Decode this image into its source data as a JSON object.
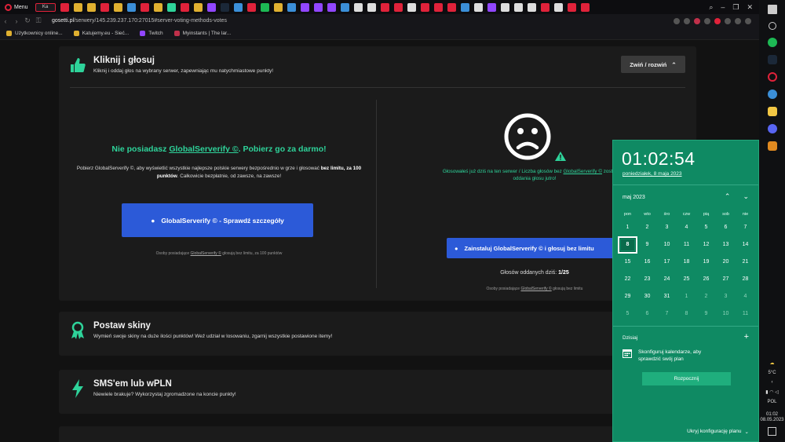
{
  "browser": {
    "menu_label": "Menu",
    "active_tab_label": "Ka",
    "url_host": "gosetti.pl",
    "url_path": "/serwery/145.239.237.170:27015#server-voting-methods-votes",
    "bookmarks": [
      {
        "label": "Użytkownicy online...",
        "color": "#e0b030"
      },
      {
        "label": "Katujemy.eu - Sieć...",
        "color": "#e0b030"
      },
      {
        "label": "Twitch",
        "color": "#9146ff"
      },
      {
        "label": "Myinstants | The lar...",
        "color": "#c0304a"
      }
    ]
  },
  "vote_section": {
    "title": "Kliknij i głosuj",
    "subtitle": "Kliknij i oddaj głos na wybrany serwer, zapewniając mu natychmiastowe punkty!",
    "collapse_label": "Zwiń / rozwiń",
    "left": {
      "promo_prefix": "Nie posiadasz ",
      "promo_link": "GlobalServerify ©",
      "promo_suffix": ". Pobierz go za darmo!",
      "desc_part1": "Pobierz GlobalServerify ©, aby wyświetlić wszystkie najlepsze polskie serwery bezpośrednio w grze i głosować",
      "desc_bold": "bez limitu, za 100 punktów",
      "desc_part2": ". Całkowicie bezpłatnie, od zawsze, na zawsze!",
      "button_label": "GlobalServerify © - Sprawdź szczegóły",
      "fine_prefix": "Osoby posiadające ",
      "fine_link": "GlobalServerify ©",
      "fine_suffix": " głosują bez limitu, za 100 punktów"
    },
    "right": {
      "msg_part1": "Głosowałeś już dziś na ten serwer / Liczba głosów bez ",
      "msg_link": "GlobalServerify ©",
      "msg_part2": " została wy",
      "msg_line2": "oddania głosu jutro!",
      "button_label": "Zainstaluj GlobalServerify © i głosuj bez limitu",
      "votes_label": "Głosów oddanych dziś: ",
      "votes_value": "1/25",
      "fine_prefix": "Osoby posiadające ",
      "fine_link": "GlobalServerify ©",
      "fine_suffix": " głosują bez limitu"
    }
  },
  "skins_section": {
    "title": "Postaw skiny",
    "subtitle": "Wymień swoje skiny na duże ilości punktów! Weź udział w losowaniu, zgarnij wszystkie postawione itemy!"
  },
  "sms_section": {
    "title": "SMS'em lub wPLN",
    "subtitle": "Niewiele brakuje? Wykorzystaj zgromadzone na koncie punkty!"
  },
  "calendar": {
    "time": "01:02:54",
    "date_long": "poniedziałek, 8 maja 2023",
    "month_label": "maj 2023",
    "weekdays": [
      "pon",
      "wto",
      "śro",
      "czw",
      "pią",
      "sob",
      "nie"
    ],
    "weeks": [
      [
        "1",
        "2",
        "3",
        "4",
        "5",
        "6",
        "7"
      ],
      [
        "8",
        "9",
        "10",
        "11",
        "12",
        "13",
        "14"
      ],
      [
        "15",
        "16",
        "17",
        "18",
        "19",
        "20",
        "21"
      ],
      [
        "22",
        "23",
        "24",
        "25",
        "26",
        "27",
        "28"
      ],
      [
        "29",
        "30",
        "31",
        "1",
        "2",
        "3",
        "4"
      ],
      [
        "5",
        "6",
        "7",
        "8",
        "9",
        "10",
        "11"
      ]
    ],
    "today_label": "Dzisiaj",
    "event_text_line1": "Skonfiguruj kalendarze, aby",
    "event_text_line2": "sprawdzić swój plan",
    "start_button": "Rozpocznij",
    "hide_config": "Ukryj konfigurację planu"
  },
  "taskbar": {
    "weather": "5°C",
    "language": "POL",
    "clock_time": "01:02",
    "clock_date": "08.05.2023"
  },
  "colors": {
    "accent_green": "#2ed39a",
    "button_blue": "#2c5ad8",
    "calendar_bg": "#0f8a63"
  }
}
